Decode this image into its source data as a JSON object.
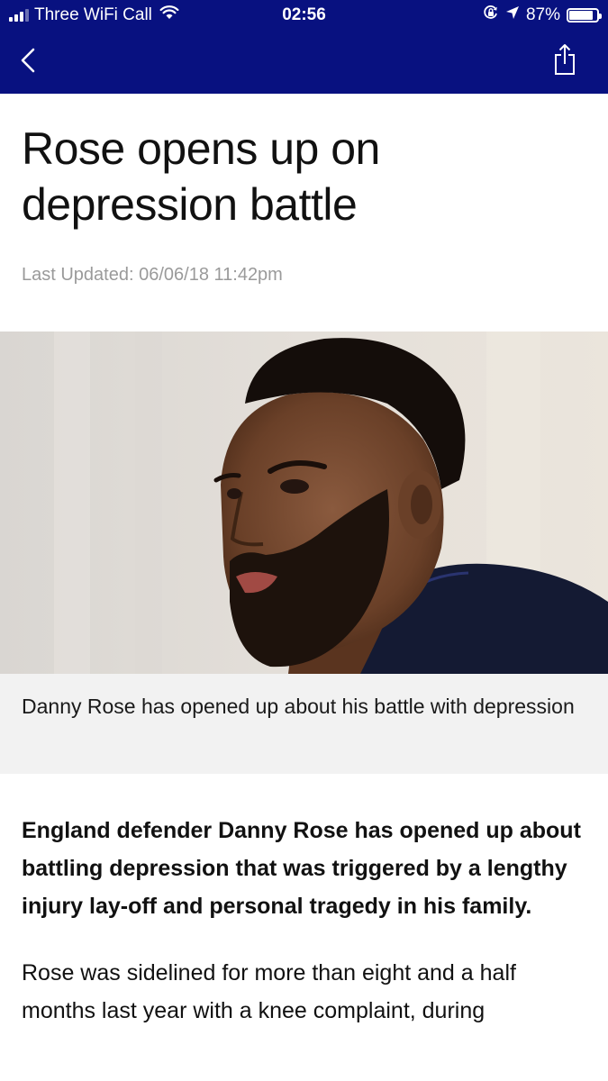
{
  "status_bar": {
    "carrier": "Three WiFi Call",
    "time": "02:56",
    "battery_percent": "87%",
    "battery_level": 0.87,
    "icons": [
      "signal-icon",
      "wifi-icon",
      "orientation-lock-icon",
      "location-icon",
      "battery-icon"
    ]
  },
  "nav": {
    "back_icon": "chevron-left-icon",
    "share_icon": "share-icon"
  },
  "article": {
    "title": "Rose opens up on depression battle",
    "last_updated": "Last Updated: 06/06/18 11:42pm",
    "image_caption": "Danny Rose has opened up about his battle with depression",
    "lede": "England defender Danny Rose has opened up about battling depression that was triggered by a lengthy injury lay-off and personal tragedy in his family.",
    "body": "Rose was sidelined for more than eight and a half months last year with a knee complaint, during"
  },
  "colors": {
    "header_bg": "#081180",
    "caption_bg": "#f2f2f2",
    "meta_text": "#9a9a9a"
  }
}
